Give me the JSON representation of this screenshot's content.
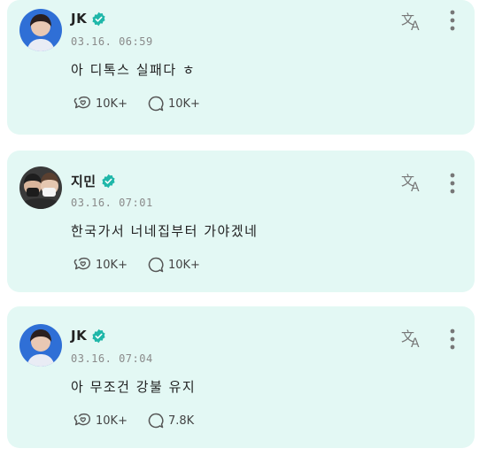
{
  "posts": [
    {
      "author": "JK",
      "time": "03.16. 06:59",
      "text": "아 디톡스 실패다 ㅎ",
      "likes": "10K+",
      "comments": "10K+",
      "icons": {
        "like": "heart-bubble-icon",
        "comment": "comment-bubble-icon",
        "translate": "translate-icon",
        "more": "more-vertical-icon",
        "verified": "verified-badge-icon"
      }
    },
    {
      "author": "지민",
      "time": "03.16. 07:01",
      "text": "한국가서 너네집부터 가야겠네",
      "likes": "10K+",
      "comments": "10K+",
      "icons": {
        "like": "heart-bubble-icon",
        "comment": "comment-bubble-icon",
        "translate": "translate-icon",
        "more": "more-vertical-icon",
        "verified": "verified-badge-icon"
      }
    },
    {
      "author": "JK",
      "time": "03.16. 07:04",
      "text": "아 무조건 강불 유지",
      "likes": "10K+",
      "comments": "7.8K",
      "icons": {
        "like": "heart-bubble-icon",
        "comment": "comment-bubble-icon",
        "translate": "translate-icon",
        "more": "more-vertical-icon",
        "verified": "verified-badge-icon"
      }
    }
  ],
  "colors": {
    "card": "#e3f8f4",
    "verified": "#1fb7a9",
    "text": "#222222",
    "muted": "#8a8a8a"
  }
}
